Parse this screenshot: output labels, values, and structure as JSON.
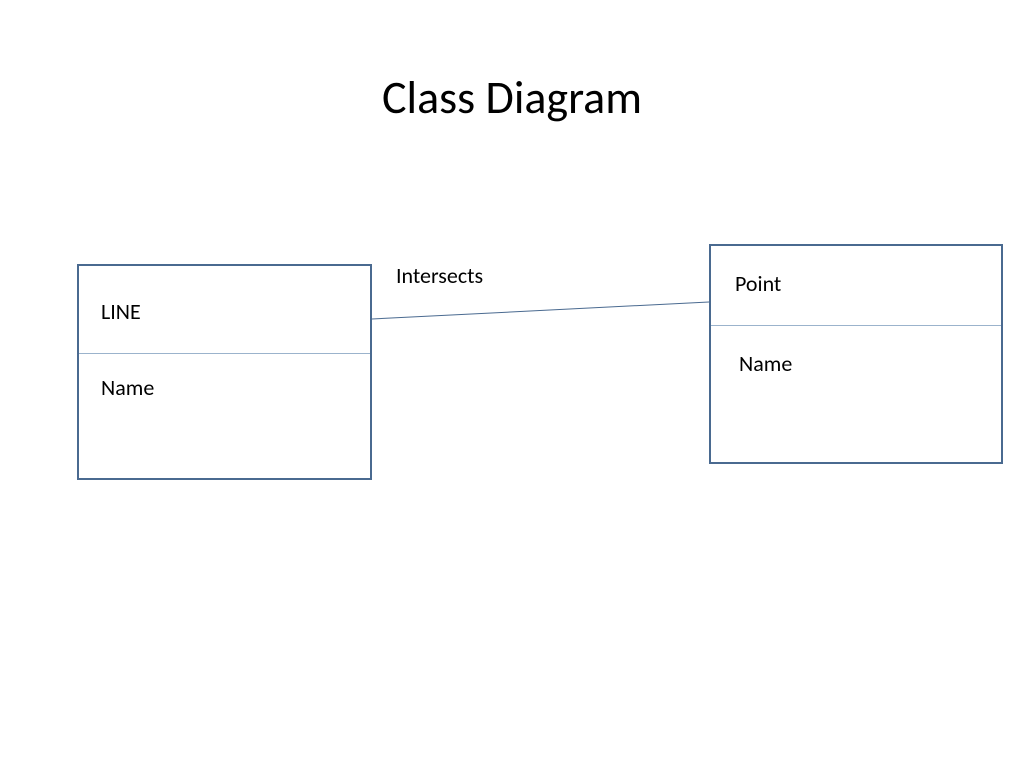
{
  "title": "Class Diagram",
  "classes": {
    "line": {
      "name": "LINE",
      "attribute": "Name"
    },
    "point": {
      "name": "Point",
      "attribute": "Name"
    }
  },
  "association": {
    "label": "Intersects"
  }
}
